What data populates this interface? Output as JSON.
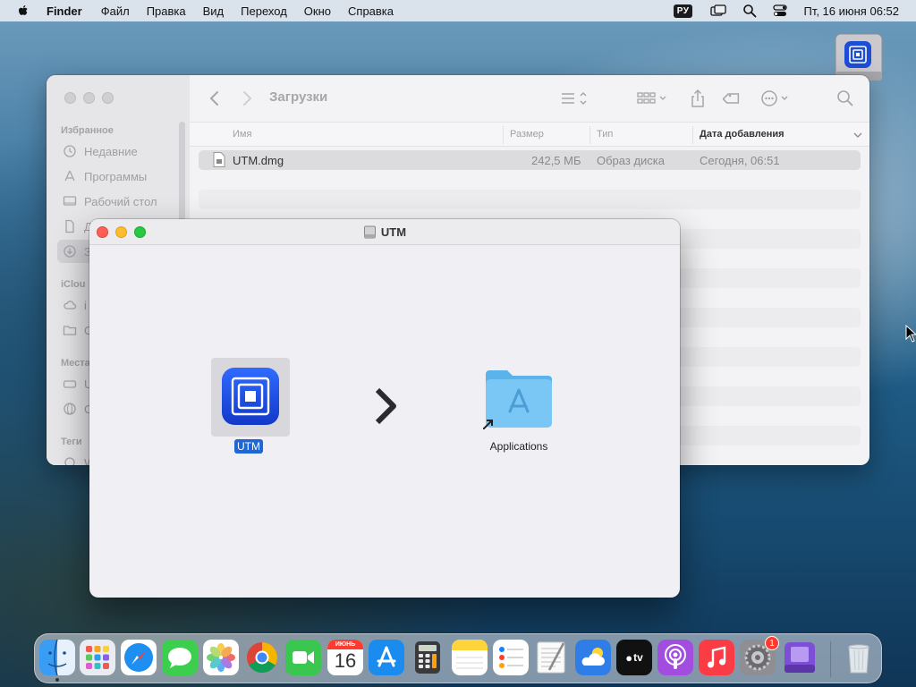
{
  "menubar": {
    "app_name": "Finder",
    "items": [
      "Файл",
      "Правка",
      "Вид",
      "Переход",
      "Окно",
      "Справка"
    ],
    "input_source": "РУ",
    "clock": "Пт, 16 июня  06:52"
  },
  "finder": {
    "folder_title": "Загрузки",
    "sidebar": {
      "favorites_heading": "Избранное",
      "favorites": [
        {
          "label": "Недавние",
          "icon": "clock-icon"
        },
        {
          "label": "Программы",
          "icon": "apps-icon"
        },
        {
          "label": "Рабочий стол",
          "icon": "desktop-icon"
        },
        {
          "label": "Д",
          "icon": "document-icon"
        },
        {
          "label": "З",
          "icon": "download-icon"
        }
      ],
      "icloud_heading": "iClou",
      "icloud_items": [
        {
          "label": "i",
          "icon": "cloud-icon"
        },
        {
          "label": "O",
          "icon": "shared-folder-icon"
        }
      ],
      "locations_heading": "Места",
      "locations_items": [
        {
          "label": "U",
          "icon": "drive-icon"
        },
        {
          "label": "C",
          "icon": "network-icon"
        }
      ],
      "tags_heading": "Теги",
      "tags_items": [
        {
          "label": "W",
          "icon": "tag-circle-icon"
        }
      ]
    },
    "columns": {
      "name": "Имя",
      "size": "Размер",
      "kind": "Тип",
      "date_added": "Дата добавления"
    },
    "files": [
      {
        "name": "UTM.dmg",
        "size": "242,5 МБ",
        "kind": "Образ диска",
        "date_added": "Сегодня, 06:51"
      }
    ]
  },
  "dmg_window": {
    "title": "UTM",
    "app_label": "UTM",
    "folder_label": "Applications"
  },
  "dock": {
    "calendar_month": "ИЮНЬ",
    "calendar_day": "16",
    "tv_label": "tv",
    "settings_badge": "1",
    "apps": [
      "finder-icon",
      "launchpad-icon",
      "safari-icon",
      "messages-icon",
      "photos-icon",
      "chrome-icon",
      "facetime-icon",
      "calendar-icon",
      "app-store-icon",
      "calculator-icon",
      "notes-icon",
      "reminders-icon",
      "textedit-icon",
      "weather-icon",
      "apple-tv-icon",
      "podcasts-icon",
      "music-icon",
      "system-settings-icon",
      "utm-disk-icon",
      "trash-icon"
    ]
  },
  "colors": {
    "accent": "#1f66d8",
    "close": "#ff5f57",
    "minimize": "#febc2e",
    "maximize": "#28c840"
  }
}
